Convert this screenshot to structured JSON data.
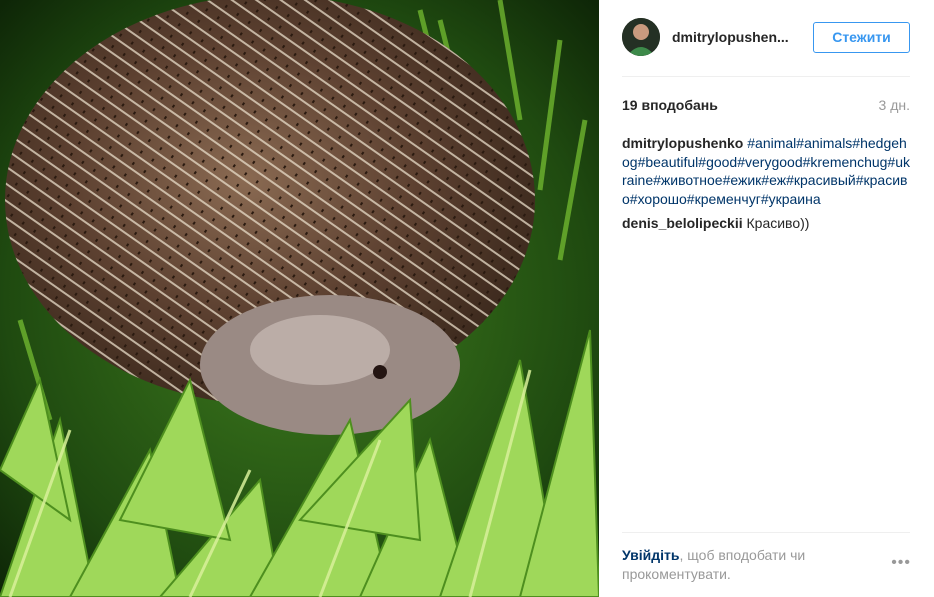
{
  "post": {
    "photo_alt": "hedgehog in grass",
    "author": "dmitrylopushen...",
    "follow_label": "Стежити",
    "likes": "19 вподобань",
    "age": "3 дн.",
    "caption_user": "dmitrylopushenko",
    "caption_tags": "#animal#animals#hedgehog#beautiful#good#verygood#kremenchug#ukraine#животное#ежик#еж#красивый#красиво#хорошо#кременчуг#украина",
    "comment_user": "denis_belolipeckii",
    "comment_text": "Красиво))",
    "login_link": "Увійдіть",
    "login_text": ", щоб вподобати чи прокоментувати.",
    "more_label": "•••"
  },
  "colors": {
    "accent": "#3897f0",
    "link": "#003569",
    "muted": "#999999"
  }
}
